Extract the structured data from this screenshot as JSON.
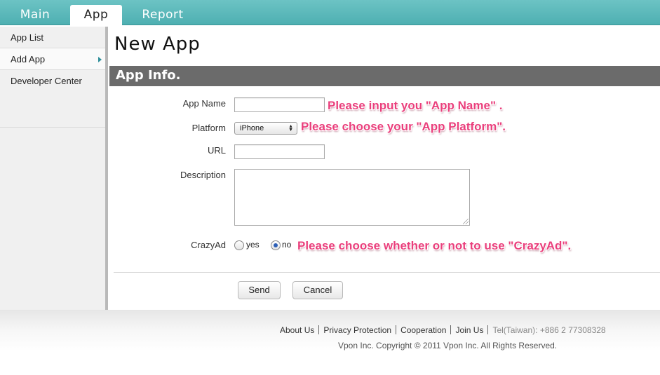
{
  "tabs": [
    {
      "label": "Main"
    },
    {
      "label": "App",
      "active": true
    },
    {
      "label": "Report"
    }
  ],
  "sidebar": {
    "items": [
      {
        "label": "App List"
      },
      {
        "label": "Add App",
        "active": true
      },
      {
        "label": "Developer Center"
      }
    ]
  },
  "page": {
    "title": "New App",
    "section_title": "App Info."
  },
  "form": {
    "app_name_label": "App Name",
    "app_name_value": "",
    "platform_label": "Platform",
    "platform_value": "iPhone",
    "url_label": "URL",
    "url_value": "",
    "description_label": "Description",
    "description_value": "",
    "crazyad_label": "CrazyAd",
    "crazyad_options": [
      "yes",
      "no"
    ],
    "crazyad_selected": "no",
    "send_label": "Send",
    "cancel_label": "Cancel"
  },
  "hints": {
    "app_name": "Please input you \"App Name\" .",
    "platform": "Please choose your \"App Platform\".",
    "crazyad": "Please choose whether or not to use \"CrazyAd\"."
  },
  "footer": {
    "links": [
      "About Us",
      "Privacy Protection",
      "Cooperation",
      "Join Us"
    ],
    "tel": "Tel(Taiwan): +886 2 77308328",
    "copyright": "Vpon Inc. Copyright © 2011 Vpon Inc. All Rights Reserved."
  },
  "colors": {
    "topbar": "#5bb9bb",
    "section_bar": "#6b6b6b",
    "hint": "#ea3f7c",
    "sidebar_arrow": "#2f8f9a"
  }
}
